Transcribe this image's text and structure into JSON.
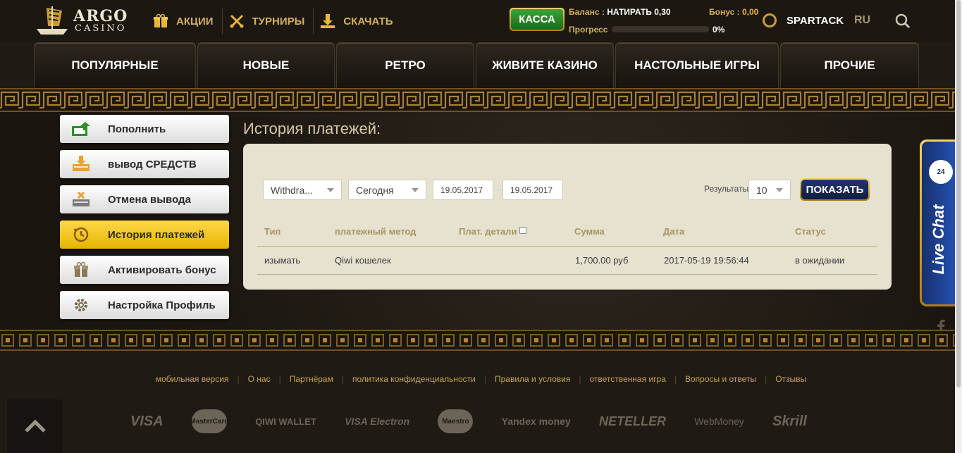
{
  "logo": {
    "line1": "ARGO",
    "line2": "CASINO"
  },
  "topnav": [
    {
      "label": "АКЦИИ",
      "icon": "gift-icon"
    },
    {
      "label": "ТУРНИРЫ",
      "icon": "crossed-swords-icon"
    },
    {
      "label": "СКАЧАТЬ",
      "icon": "download-icon"
    }
  ],
  "header": {
    "kassa_label": "КАССА",
    "balance_label": "Баланс :",
    "balance_value": "НАТИРАТЬ 0,30",
    "bonus_label": "Бонус :",
    "bonus_value": "0,00",
    "progress_label": "Прогресс",
    "progress_value": "0%",
    "progress_fraction": 0,
    "username": "SPARTACK",
    "language": "RU"
  },
  "categories": [
    {
      "label": "ПОПУЛЯРНЫЕ"
    },
    {
      "label": "НОВЫЕ"
    },
    {
      "label": "РЕТРО"
    },
    {
      "label": "ЖИВИТЕ КАЗИНО"
    },
    {
      "label": "НАСТОЛЬНЫЕ ИГРЫ"
    },
    {
      "label": "ПРОЧИЕ"
    }
  ],
  "sidebar": [
    {
      "label": "Пополнить",
      "icon": "deposit-icon",
      "active": false
    },
    {
      "label": "вывод СРЕДСТВ",
      "icon": "withdraw-icon",
      "active": false
    },
    {
      "label": "Отмена вывода",
      "icon": "cancel-withdraw-icon",
      "active": false
    },
    {
      "label": "История платежей",
      "icon": "history-icon",
      "active": true
    },
    {
      "label": "Активировать бонус",
      "icon": "gift-icon",
      "active": false
    },
    {
      "label": "Настройка Профиль",
      "icon": "gear-icon",
      "active": false
    }
  ],
  "page": {
    "title": "История платежей:",
    "filters": {
      "type_value": "Withdra...",
      "period_value": "Сегодня",
      "date_from": "19.05.2017",
      "date_to": "19.05.2017",
      "date_separator": "-",
      "results_label": "Результаты:",
      "results_value": "10",
      "show_button": "ПОКАЗАТЬ"
    },
    "table": {
      "headers": {
        "type": "Тип",
        "method": "платежный метод",
        "details": "Плат. детали",
        "amount": "Сумма",
        "date": "Дата",
        "status": "Статус"
      },
      "rows": [
        {
          "type": "изымать",
          "method": "Qiwi кошелек",
          "details": "",
          "amount": "1,700.00 руб",
          "date": "2017-05-19 19:56:44",
          "status": "в ожидании"
        }
      ]
    }
  },
  "livechat": {
    "label": "Live Chat",
    "badge": "24"
  },
  "social": [
    "facebook-icon",
    "vk-icon",
    "email-icon"
  ],
  "footer": {
    "links": [
      "мобильная версия",
      "О нас",
      "Партнёрам",
      "политика конфиденциальности",
      "Правила и условия",
      "ответственная игра",
      "Вопросы и ответы",
      "Отзывы"
    ],
    "payments": {
      "visa": "VISA",
      "mastercard": "MasterCard",
      "qiwi": "QIWI WALLET",
      "visa_electron": "VISA Electron",
      "maestro": "Maestro",
      "yandex": "Yandex money",
      "neteller": "NETELLER",
      "webmoney": "WebMoney",
      "skrill": "Skrill"
    }
  },
  "colors": {
    "gold": "#d4b15a",
    "kassa_green": "#2f8f2b",
    "active_yellow": "#f5c800",
    "panel_bg": "#e7e2d0",
    "livechat_blue": "#1c3d8c"
  }
}
